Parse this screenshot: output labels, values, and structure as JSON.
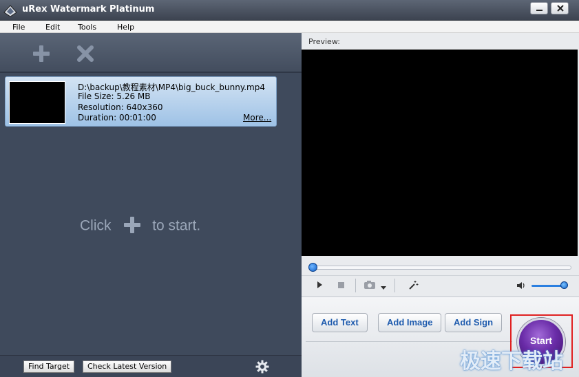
{
  "window": {
    "title": "uRex Watermark Platinum"
  },
  "menu": {
    "items": [
      "File",
      "Edit",
      "Tools",
      "Help"
    ]
  },
  "file_list": {
    "items": [
      {
        "path": "D:\\backup\\教程素材\\MP4\\big_buck_bunny.mp4",
        "file_size": "File Size: 5.26 MB",
        "resolution": "Resolution: 640x360",
        "duration": "Duration: 00:01:00",
        "more_link": "More..."
      }
    ],
    "empty_hint_before": "Click",
    "empty_hint_after": "to start."
  },
  "bottom_bar": {
    "find_target": "Find Target",
    "check_version": "Check Latest Version"
  },
  "preview": {
    "label": "Preview:",
    "seek_progress": 0.0,
    "volume_level": 0.9
  },
  "actions": {
    "add_text": "Add Text",
    "add_image": "Add Image",
    "add_sign": "Add Sign",
    "start": "Start"
  },
  "watermark_text": "极速下载站",
  "colors": {
    "title_bar": "#3c4350",
    "left_panel": "#3f4a5c",
    "file_item": "#9ec2e6",
    "action_text": "#1f5cae",
    "start_button": "#6a2ca8",
    "highlight_border": "#e02020"
  },
  "icons": [
    "app-logo-icon",
    "minimize-icon",
    "close-icon",
    "add-file-icon",
    "remove-file-icon",
    "plus-icon",
    "gear-icon",
    "play-icon",
    "stop-icon",
    "snapshot-icon",
    "dropdown-arrow-icon",
    "effects-wand-icon",
    "volume-icon"
  ]
}
